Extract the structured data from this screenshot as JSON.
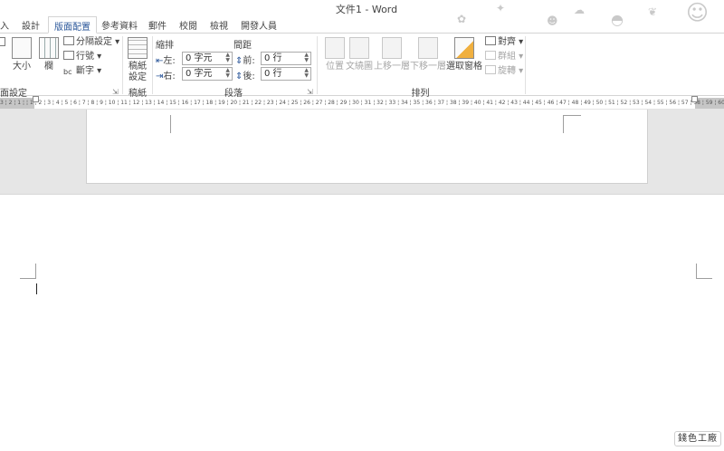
{
  "window": {
    "title": "文件1 - Word"
  },
  "tabs": [
    {
      "label": "入",
      "active": false
    },
    {
      "label": "設計",
      "active": false
    },
    {
      "label": "版面配置",
      "active": true
    },
    {
      "label": "參考資料",
      "active": false
    },
    {
      "label": "郵件",
      "active": false
    },
    {
      "label": "校閱",
      "active": false
    },
    {
      "label": "檢視",
      "active": false
    },
    {
      "label": "開發人員",
      "active": false
    }
  ],
  "ribbon": {
    "page_setup": {
      "group_label": "面設定",
      "size_label": "大小",
      "columns_label": "欄",
      "breaks_label": "分隔設定",
      "line_numbers_label": "行號",
      "hyphenation_label": "斷字"
    },
    "draft": {
      "group_label": "稿紙",
      "button_line1": "稿紙",
      "button_line2": "設定"
    },
    "paragraph": {
      "group_label": "段落",
      "indent_header": "縮排",
      "spacing_header": "間距",
      "left_label": "左:",
      "left_value": "0 字元",
      "right_label": "右:",
      "right_value": "0 字元",
      "before_label": "前:",
      "before_value": "0 行",
      "after_label": "後:",
      "after_value": "0 行"
    },
    "arrange": {
      "group_label": "排列",
      "position_label": "位置",
      "wrap_label": "文繞圖",
      "bring_forward_label": "上移一層",
      "send_backward_label": "下移一層",
      "selection_pane_label": "選取窗格",
      "align_label": "對齊",
      "group_btn_label": "群組",
      "rotate_label": "旋轉"
    }
  },
  "ruler": {
    "text": "3 ¦ 2 ¦ 1 ¦  ¦ 1 ¦ 2 ¦ 3 ¦ 4 ¦ 5 ¦ 6 ¦ 7 ¦ 8 ¦ 9 ¦ 10 ¦ 11 ¦ 12 ¦ 13 ¦ 14 ¦ 15 ¦ 16 ¦ 17 ¦ 18 ¦ 19 ¦ 20 ¦ 21 ¦ 22 ¦ 23 ¦ 24 ¦ 25 ¦ 26 ¦ 27 ¦ 28 ¦ 29 ¦ 30 ¦ 31 ¦ 32 ¦ 33 ¦ 34 ¦ 35 ¦ 36 ¦ 37 ¦ 38 ¦ 39 ¦ 40 ¦ 41 ¦ 42 ¦ 43 ¦ 44 ¦ 45 ¦ 46 ¦ 47 ¦ 48 ¦ 49 ¦ 50 ¦ 51 ¦ 52 ¦ 53 ¦ 54 ¦ 55 ¦ 56 ¦ 57 ¦ 58 ¦ 59 ¦ 60"
  },
  "watermark": {
    "text": "錢色工廠"
  }
}
